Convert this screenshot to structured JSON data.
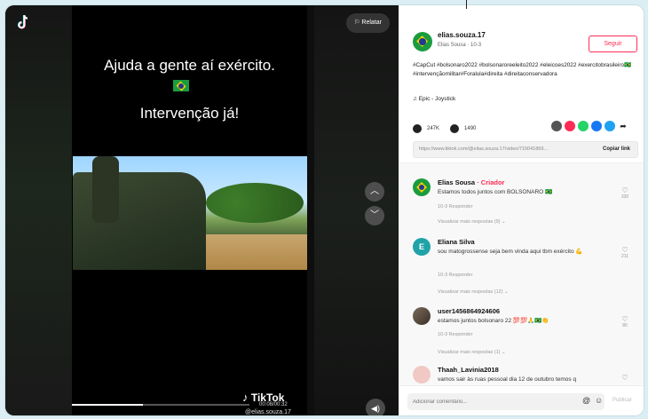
{
  "video": {
    "report_label": "Relatar",
    "overlay_line1": "Ajuda a gente aí exército.",
    "overlay_line2": "Intervenção já!",
    "brand": "TikTok",
    "time": "00:08/00:32",
    "handle": "@elias.souza.17"
  },
  "author": {
    "username": "elias.souza.17",
    "subtitle": "Elias Sousa · 10-3",
    "follow_label": "Seguir"
  },
  "post": {
    "description": "#CapCut #bolsonaro2022 #bolsonaroreeleito2022 #eleicoes2022 #exercitobrasileiro🇧🇷 #intervençãomilitar#Foralula#direita #direitaconservadora",
    "music": "Epic - Joystick",
    "likes": "247K",
    "comments_count": "1490",
    "link_url": "https://www.tiktok.com/@elias.souza.17/video/715041869...",
    "copy_label": "Copiar link"
  },
  "comments": [
    {
      "name": "Elias Sousa",
      "creator_tag": " · Criador",
      "text": "Estamos todos juntos com BOLSONARO 🇧🇷",
      "meta": "10-3     Responder",
      "likes": "330",
      "more": "Visualizar mais respostas (9) ⌄"
    },
    {
      "initial": "E",
      "name": "Eliana Silva",
      "text": "sou matogrossense seja bem vinda aqui tbm exército 💪",
      "meta": "10-3     Responder",
      "likes": "211",
      "more": "Visualizar mais respostas (12) ⌄"
    },
    {
      "name": "user1456864924606",
      "text": "estamos juntos bolsonaro 22 💯💯🙏🇧🇷👏",
      "meta": "10-3     Responder",
      "likes": "80",
      "more": "Visualizar mais respostas (1) ⌄"
    },
    {
      "name": "Thaah_Lavinia2018",
      "text": "vamos sair às ruas pessoal dia 12 de outubro temos q"
    }
  ],
  "footer": {
    "placeholder": "Adicionar comentário...",
    "post_label": "Publicar"
  },
  "colors": {
    "accent": "#fe2c55",
    "flag_green": "#1a9c3e",
    "flag_yellow": "#f4d000",
    "flag_blue": "#213a8f"
  }
}
